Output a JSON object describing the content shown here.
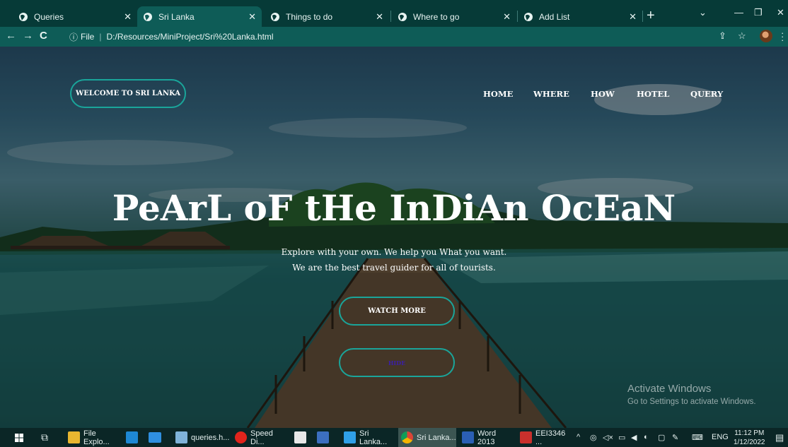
{
  "browser": {
    "tabs": [
      {
        "label": "Queries"
      },
      {
        "label": "Sri Lanka"
      },
      {
        "label": "Things to do"
      },
      {
        "label": "Where to go"
      },
      {
        "label": "Add List"
      }
    ],
    "new_tab_icon": "plus-icon",
    "address": {
      "info_label": "File",
      "url": "D:/Resources/MiniProject/Sri%20Lanka.html"
    }
  },
  "site": {
    "welcome_label": "WELCOME TO SRI LANKA",
    "nav": [
      "HOME",
      "WHERE",
      "HOW",
      "HOTEL",
      "QUERY"
    ],
    "headline": "PeArL oF tHe InDiAn OcEaN",
    "subline_1": "Explore with your own. We help you What you want.",
    "subline_2": "We are the best travel guider for all of tourists.",
    "watch_more_label": "WATCH MORE",
    "second_button_label": "HIDE"
  },
  "watermark": {
    "title": "Activate Windows",
    "subtitle": "Go to Settings to activate Windows."
  },
  "taskbar": {
    "items": [
      {
        "label": "File Explo..."
      },
      {
        "label": "queries.h..."
      },
      {
        "label": "Speed Di..."
      },
      {
        "label": "Sri Lanka..."
      },
      {
        "label": "Sri Lanka..."
      },
      {
        "label": "Word 2013"
      },
      {
        "label": "EEI3346 ..."
      }
    ],
    "language": "ENG",
    "time": "11:12 PM",
    "date": "1/12/2022"
  }
}
